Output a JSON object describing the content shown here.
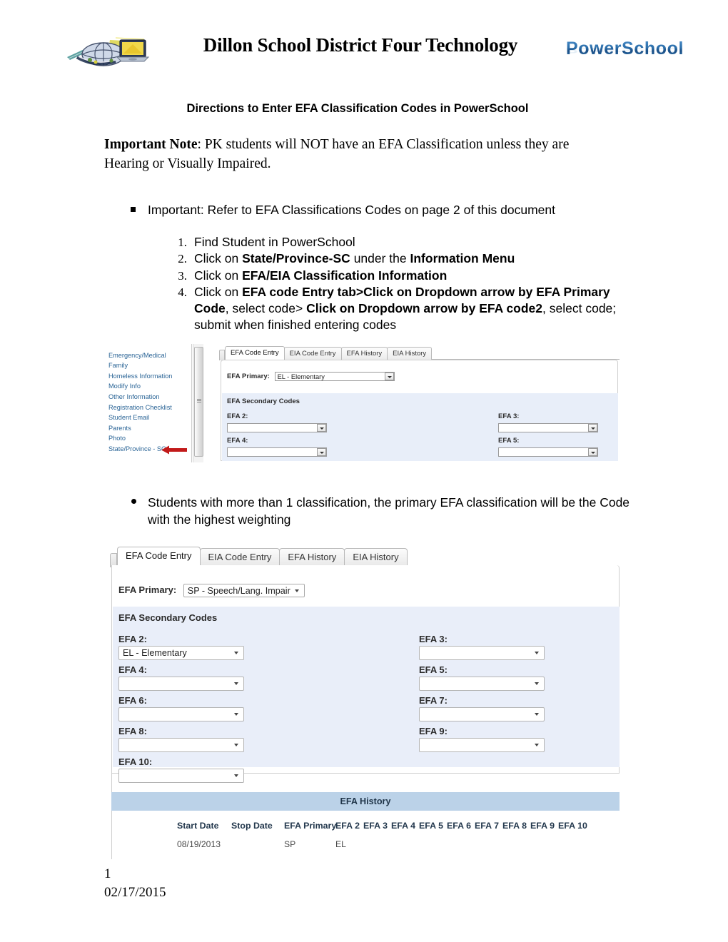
{
  "header": {
    "title": "Dillon School District Four Technology",
    "logo_icon": "district-globe-computer-logo",
    "powerschool_logo": "PowerSchool"
  },
  "subtitle": "Directions to Enter EFA Classification Codes in PowerSchool",
  "note": {
    "bold_lead": "Important Note",
    "rest": ": PK students will NOT have an EFA Classification unless they are Hearing or Visually Impaired."
  },
  "square_bullet": "Important: Refer to EFA Classifications Codes on page 2 of this document",
  "steps": [
    {
      "num": "1.",
      "html": "Find Student in PowerSchool"
    },
    {
      "num": "2.",
      "html": "Click on <b>State/Province-SC</b> under the <b>Information Menu</b>"
    },
    {
      "num": "3.",
      "html": "Click on <b>EFA/EIA Classification Information</b>"
    },
    {
      "num": "4.",
      "html": "Click on <b>EFA code Entry tab&gt;Click on Dropdown arrow by EFA Primary Code</b>, select code&gt; <b>Click on Dropdown arrow by EFA code2</b>, select code; submit when finished entering codes"
    }
  ],
  "round_bullet": "Students with more than 1 classification, the primary EFA classification will be the Code with the highest weighting",
  "screenshot1": {
    "sidebar_items": [
      "Emergency/Medical",
      "Family",
      "Homeless Information",
      "Modify Info",
      "Other Information",
      "Registration Checklist",
      "Student Email",
      "Parents",
      "Photo",
      "State/Province - SC"
    ],
    "arrow_icon": "red-left-arrow-icon",
    "tabs": [
      "EFA Code Entry",
      "EIA Code Entry",
      "EFA History",
      "EIA History"
    ],
    "active_tab": "EFA Code Entry",
    "primary_label": "EFA Primary:",
    "primary_value": "EL - Elementary",
    "secondary_title": "EFA Secondary Codes",
    "fields": [
      {
        "label": "EFA 2:",
        "value": ""
      },
      {
        "label": "EFA 3:",
        "value": ""
      },
      {
        "label": "EFA 4:",
        "value": ""
      },
      {
        "label": "EFA 5:",
        "value": ""
      }
    ]
  },
  "screenshot2": {
    "tabs": [
      "EFA Code Entry",
      "EIA Code Entry",
      "EFA History",
      "EIA History"
    ],
    "active_tab": "EFA Code Entry",
    "primary_label": "EFA Primary:",
    "primary_value": "SP - Speech/Lang. Impair",
    "secondary_title": "EFA Secondary Codes",
    "fields": [
      {
        "label": "EFA 2:",
        "value": "EL - Elementary"
      },
      {
        "label": "EFA 3:",
        "value": ""
      },
      {
        "label": "EFA 4:",
        "value": ""
      },
      {
        "label": "EFA 5:",
        "value": ""
      },
      {
        "label": "EFA 6:",
        "value": ""
      },
      {
        "label": "EFA 7:",
        "value": ""
      },
      {
        "label": "EFA 8:",
        "value": ""
      },
      {
        "label": "EFA 9:",
        "value": ""
      },
      {
        "label": "EFA 10:",
        "value": ""
      }
    ],
    "history": {
      "title": "EFA History",
      "columns": [
        "Start Date",
        "Stop Date",
        "EFA Primary",
        "EFA 2",
        "EFA 3",
        "EFA 4",
        "EFA 5",
        "EFA 6",
        "EFA 7",
        "EFA 8",
        "EFA 9",
        "EFA 10"
      ],
      "rows": [
        [
          "08/19/2013",
          "",
          "SP",
          "EL",
          "",
          "",
          "",
          "",
          "",
          "",
          "",
          ""
        ]
      ]
    }
  },
  "footer": {
    "page_number": "1",
    "date": "02/17/2015"
  },
  "colors": {
    "link_blue": "#2a6496",
    "panel_blue": "#e9eef9",
    "history_header_blue": "#bbd2e8",
    "arrow_red": "#c21a1a",
    "powerschool_blue": "#1f6cb0"
  }
}
